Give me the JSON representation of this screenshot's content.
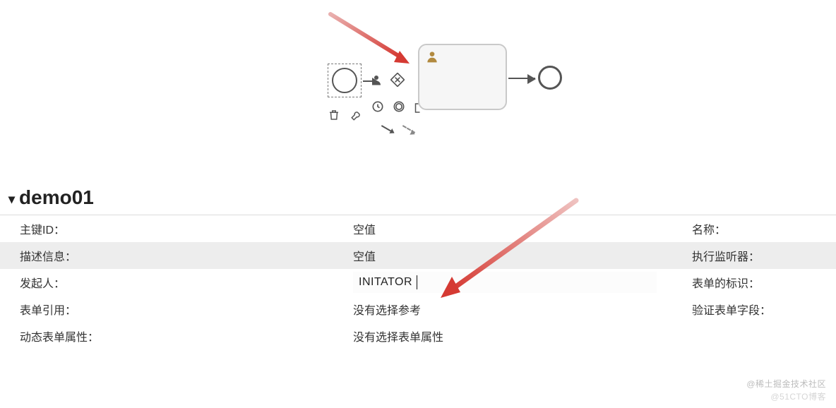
{
  "section": {
    "title": "demo01"
  },
  "form": {
    "rows": [
      {
        "label": "主键ID：",
        "value": "空值",
        "rlabel": "名称："
      },
      {
        "label": "描述信息：",
        "value": "空值",
        "rlabel": "执行监听器："
      },
      {
        "label": "发起人：",
        "value": "INITATOR",
        "rlabel": "表单的标识："
      },
      {
        "label": "表单引用：",
        "value": "没有选择参考",
        "rlabel": "验证表单字段："
      },
      {
        "label": "动态表单属性：",
        "value": "没有选择表单属性",
        "rlabel": ""
      }
    ]
  },
  "watermark": {
    "line1": "@稀土掘金技术社区",
    "line2": "@51CTO博客"
  },
  "icons": {
    "user": "user-icon",
    "gateway": "gateway-icon",
    "trash": "trash-icon",
    "wrench": "wrench-icon",
    "timer": "timer-icon",
    "ring": "intermediate-event-icon",
    "text": "text-annotation-icon",
    "seq": "sequence-flow-icon",
    "seqd": "association-icon"
  }
}
